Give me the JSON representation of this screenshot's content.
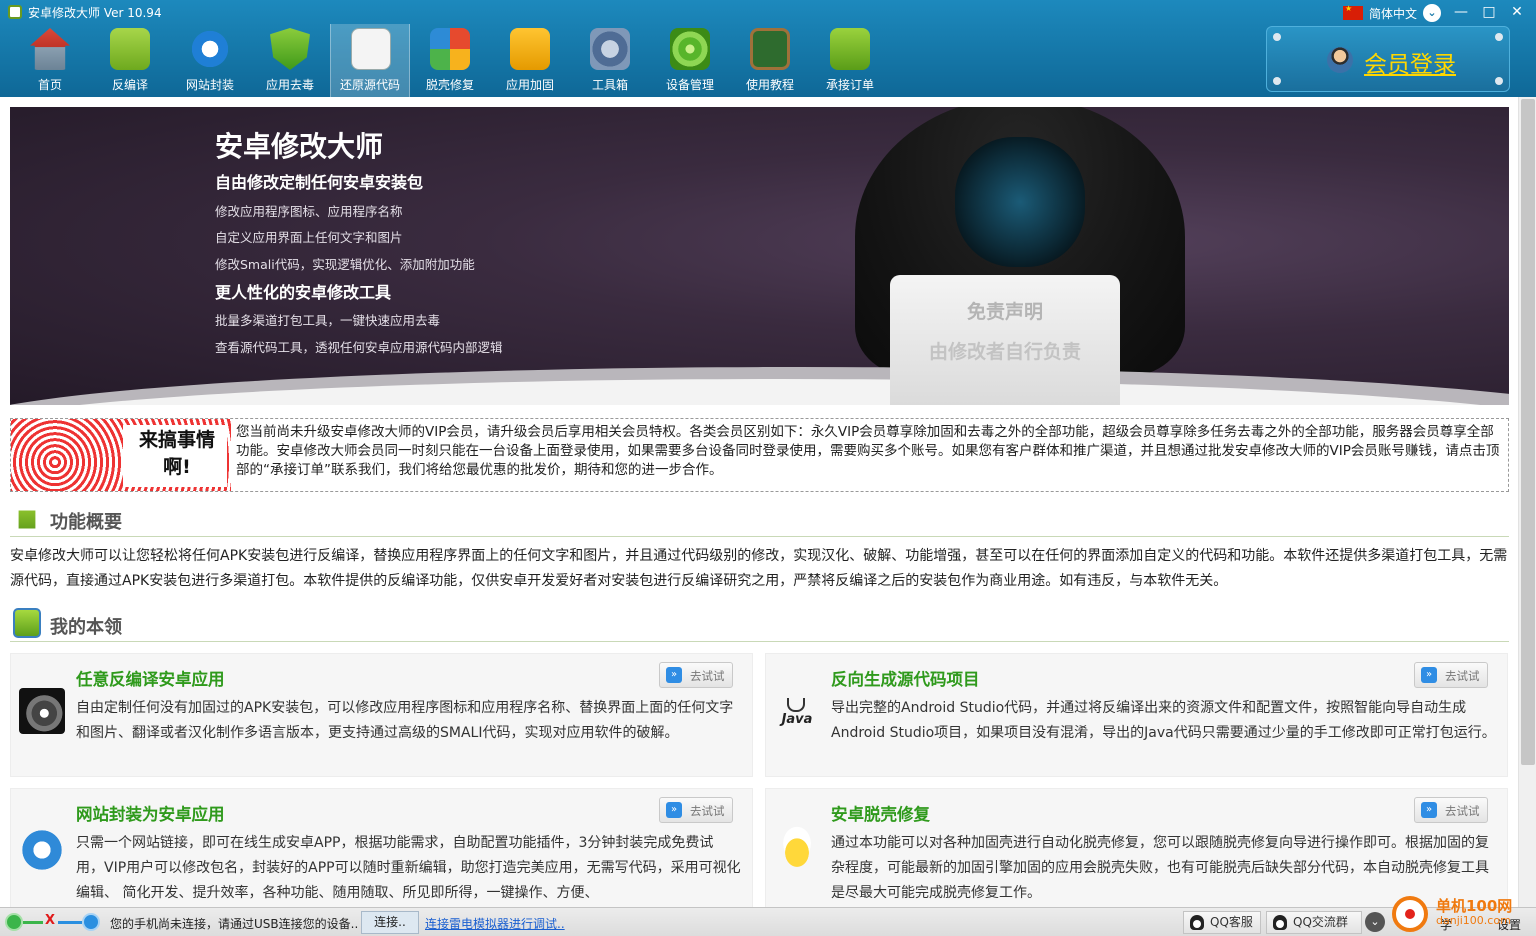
{
  "window": {
    "title": "安卓修改大师 Ver 10.94",
    "language": "简体中文",
    "controls": [
      "—",
      "□",
      "✕"
    ]
  },
  "toolbar": {
    "items": [
      {
        "label": "首页",
        "icon": "home-icon"
      },
      {
        "label": "反编译",
        "icon": "android-icon"
      },
      {
        "label": "网站封装",
        "icon": "ie-icon"
      },
      {
        "label": "应用去毒",
        "icon": "shield-icon"
      },
      {
        "label": "还原源代码",
        "icon": "document-icon"
      },
      {
        "label": "脱壳修复",
        "icon": "ball-icon"
      },
      {
        "label": "应用加固",
        "icon": "lock-icon"
      },
      {
        "label": "工具箱",
        "icon": "toolbox-icon"
      },
      {
        "label": "设备管理",
        "icon": "radar-icon"
      },
      {
        "label": "使用教程",
        "icon": "blackboard-icon"
      },
      {
        "label": "承接订单",
        "icon": "go-bag-icon"
      }
    ],
    "active": "还原源代码",
    "member_login": "会员登录"
  },
  "banner": {
    "title": "安卓修改大师",
    "heading1": "自由修改定制任何安卓安装包",
    "lines1": [
      "修改应用程序图标、应用程序名称",
      "自定义应用界面上任何文字和图片",
      "修改Smali代码，实现逻辑优化、添加附加功能"
    ],
    "heading2": "更人性化的安卓修改工具",
    "lines2": [
      "批量多渠道打包工具，一键快速应用去毒",
      "查看源代码工具，透视任何安卓应用源代码内部逻辑"
    ],
    "laptop_title": "免责声明",
    "laptop_sub": "由修改者自行负责"
  },
  "notice": {
    "promo": "来搞事情啊!",
    "text": "您当前尚未升级安卓修改大师的VIP会员，请升级会员后享用相关会员特权。各类会员区别如下：永久VIP会员尊享除加固和去毒之外的全部功能，超级会员尊享除多任务去毒之外的全部功能，服务器会员尊享全部功能。安卓修改大师会员同一时刻只能在一台设备上面登录使用，如果需要多台设备同时登录使用，需要购买多个账号。如果您有客户群体和推广渠道，并且想通过批发安卓修改大师的VIP会员账号赚钱，请点击顶部的“承接订单”联系我们，我们将给您最优惠的批发价，期待和您的进一步合作。"
  },
  "overview": {
    "title": "功能概要",
    "text": "安卓修改大师可以让您轻松将任何APK安装包进行反编译，替换应用程序界面上的任何文字和图片，并且通过代码级别的修改，实现汉化、破解、功能增强，甚至可以在任何的界面添加自定义的代码和功能。本软件还提供多渠道打包工具，无需源代码，直接通过APK安装包进行多渠道打包。本软件提供的反编译功能，仅供安卓开发爱好者对安装包进行反编译研究之用，严禁将反编译之后的安装包作为商业用途。如有违反，与本软件无关。"
  },
  "skills": {
    "title": "我的本领",
    "try_label": "去试试",
    "cards": [
      {
        "title": "任意反编译安卓应用",
        "icon": "gear-icon",
        "text": "自由定制任何没有加固过的APK安装包，可以修改应用程序图标和应用程序名称、替换界面上面的任何文字和图片、翻译或者汉化制作多语言版本，更支持通过高级的SMALI代码，实现对应用软件的破解。"
      },
      {
        "title": "反向生成源代码项目",
        "icon": "java-icon",
        "icon_text": "Java",
        "text": "导出完整的Android Studio代码，并通过将反编译出来的资源文件和配置文件，按照智能向导自动生成Android Studio项目，如果项目没有混淆，导出的Java代码只需要通过少量的手工修改即可正常打包运行。"
      },
      {
        "title": "网站封装为安卓应用",
        "icon": "ie-icon",
        "text": "只需一个网站链接，即可在线生成安卓APP，根据功能需求，自助配置功能插件，3分钟封装完成免费试用，VIP用户可以修改包名，封装好的APP可以随时重新编辑，助您打造完美应用，无需写代码，采用可视化编辑、 简化开发、提升效率，各种功能、随用随取、所见即所得，一键操作、方便、"
      },
      {
        "title": "安卓脱壳修复",
        "icon": "chick-icon",
        "text": "通过本功能可以对各种加固壳进行自动化脱壳修复，您可以跟随脱壳修复向导进行操作即可。根据加固的复杂程度，可能最新的加固引擎加固的应用会脱壳失败，也有可能脱壳后缺失部分代码，本自动脱壳修复工具是尽最大可能完成脱壳修复工作。"
      }
    ]
  },
  "statusbar": {
    "x_mark": "X",
    "message": "您的手机尚未连接，请通过USB连接您的设备..",
    "connect": "连接..",
    "emulator_link": "连接雷电模拟器进行调试..",
    "qq_service": "QQ客服",
    "qq_group": "QQ交流群",
    "partial": "学",
    "settings": "设置"
  },
  "watermark": {
    "line1": "单机100网",
    "line2": "danji100.com"
  }
}
